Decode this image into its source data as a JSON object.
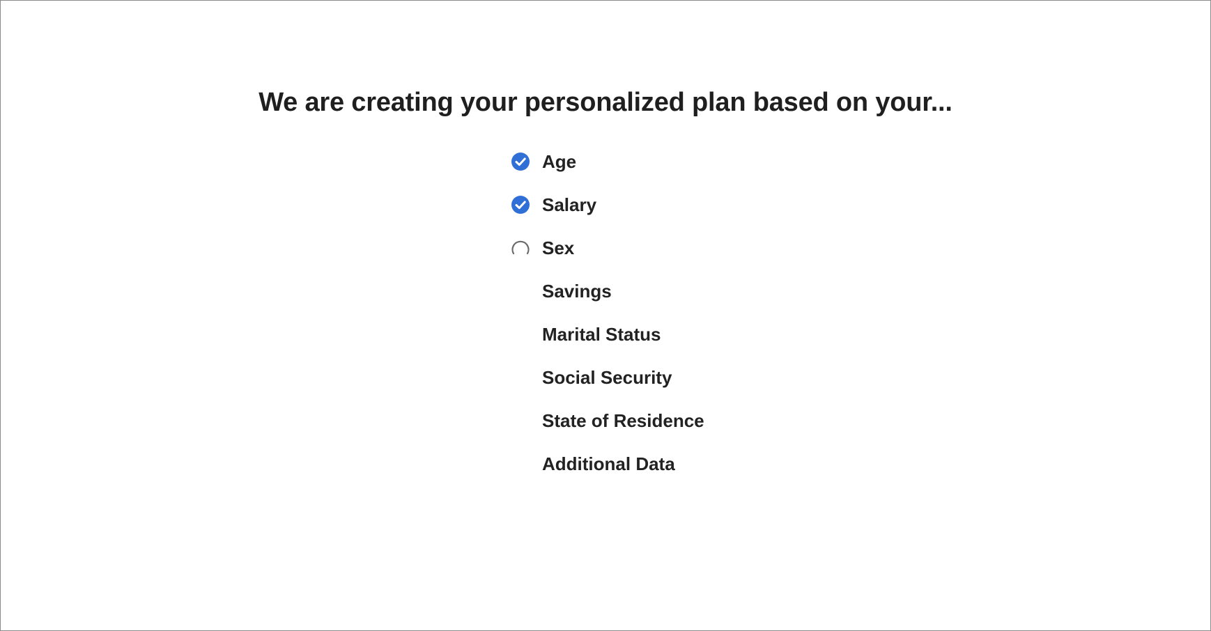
{
  "heading": "We are creating your personalized plan based on your...",
  "colors": {
    "accent": "#2f6fd6",
    "spinner": "#6b6b6b"
  },
  "items": [
    {
      "label": "Age",
      "status": "done",
      "icon": "check-circle-icon"
    },
    {
      "label": "Salary",
      "status": "done",
      "icon": "check-circle-icon"
    },
    {
      "label": "Sex",
      "status": "loading",
      "icon": "spinner-icon"
    },
    {
      "label": "Savings",
      "status": "pending",
      "icon": ""
    },
    {
      "label": "Marital Status",
      "status": "pending",
      "icon": ""
    },
    {
      "label": "Social Security",
      "status": "pending",
      "icon": ""
    },
    {
      "label": "State of Residence",
      "status": "pending",
      "icon": ""
    },
    {
      "label": "Additional Data",
      "status": "pending",
      "icon": ""
    }
  ]
}
